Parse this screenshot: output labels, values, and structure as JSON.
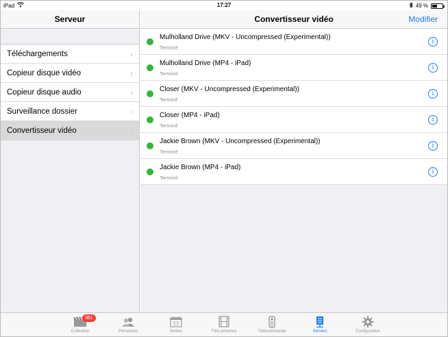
{
  "statusbar": {
    "device": "iPad",
    "time": "17:27",
    "battery": "49 %"
  },
  "master": {
    "title": "Serveur",
    "items": [
      {
        "label": "Téléchargements",
        "selected": false
      },
      {
        "label": "Copieur disque vidéo",
        "selected": false
      },
      {
        "label": "Copieur disque audio",
        "selected": false
      },
      {
        "label": "Surveillance dossier",
        "selected": false
      },
      {
        "label": "Convertisseur vidéo",
        "selected": true
      }
    ]
  },
  "detail": {
    "title": "Convertisseur vidéo",
    "edit_label": "Modifier",
    "rows": [
      {
        "name": "Mulholland Drive (MKV - Uncompressed (Experimental))",
        "status": "Terminé"
      },
      {
        "name": "Mulholland Drive (MP4 - iPad)",
        "status": "Terminé"
      },
      {
        "name": "Closer (MKV - Uncompressed (Experimental))",
        "status": "Terminé"
      },
      {
        "name": "Closer (MP4 - iPad)",
        "status": "Terminé"
      },
      {
        "name": "Jackie Brown (MKV - Uncompressed (Experimental))",
        "status": "Terminé"
      },
      {
        "name": "Jackie Brown (MP4 - iPad)",
        "status": "Terminé"
      }
    ]
  },
  "tabbar": {
    "tabs": [
      {
        "label": "Collection",
        "icon": "clapper-icon",
        "badge": "361"
      },
      {
        "label": "Personnes",
        "icon": "people-icon"
      },
      {
        "label": "Sorties",
        "icon": "calendar-icon"
      },
      {
        "label": "Film-annonce",
        "icon": "film-icon"
      },
      {
        "label": "Télécommande",
        "icon": "remote-icon"
      },
      {
        "label": "Serveur",
        "icon": "server-icon",
        "active": true
      },
      {
        "label": "Configuration",
        "icon": "gear-icon"
      }
    ]
  },
  "colors": {
    "accent": "#1a7cf5",
    "status_done": "#35b43c",
    "badge": "#ff3b30"
  }
}
